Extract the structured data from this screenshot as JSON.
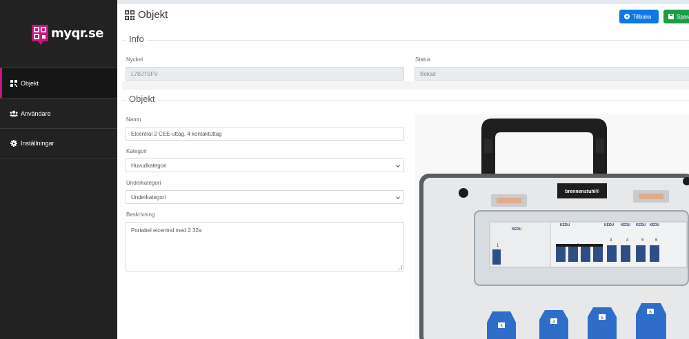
{
  "brand": {
    "name": "myqr.se"
  },
  "nav": {
    "items": [
      {
        "label": "Objekt",
        "icon": "qr-icon",
        "active": true
      },
      {
        "label": "Användare",
        "icon": "users-icon",
        "active": false
      },
      {
        "label": "Inställningar",
        "icon": "gear-icon",
        "active": false
      }
    ]
  },
  "header": {
    "title": "Objekt",
    "back_label": "Tillbaka",
    "save_label": "Spara"
  },
  "info": {
    "legend": "Info",
    "key_label": "Nyckel",
    "key_value": "L7BJTSFV",
    "status_label": "Status",
    "status_value": "Bokad"
  },
  "object": {
    "legend": "Objekt",
    "name_label": "Namn",
    "name_value": "Elcentral 2 CEE-uttag, 4 kontaktuttag",
    "category_label": "Kategori",
    "category_value": "Huvudkategori",
    "subcategory_label": "Underkategori",
    "subcategory_value": "Underkategori",
    "description_label": "Beskrivning",
    "description_value": "Portabel elcentral med 2 32a"
  },
  "image": {
    "brand_text": "brennenstuhl®",
    "breaker_brand": "KEDU",
    "module_numbers": [
      "1",
      "2",
      "3",
      "4",
      "5",
      "6"
    ],
    "socket_numbers": [
      "3",
      "4",
      "5",
      "6"
    ]
  },
  "colors": {
    "accent": "#c71580",
    "sidebar_bg": "#222222",
    "primary": "#0d78e6",
    "success": "#199e45"
  }
}
